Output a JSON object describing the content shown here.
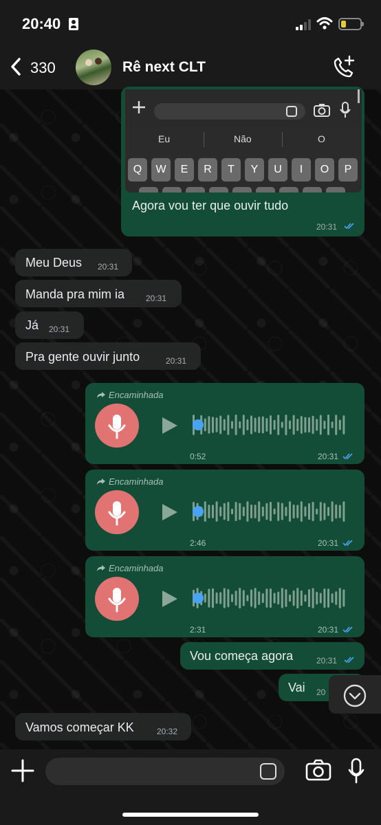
{
  "status_bar": {
    "time": "20:40"
  },
  "header": {
    "back_count": "330",
    "contact_name": "Rê next CLT"
  },
  "screenshot_keyboard": {
    "suggestions": [
      "Eu",
      "Não",
      "O"
    ],
    "keys": [
      "Q",
      "W",
      "E",
      "R",
      "T",
      "Y",
      "U",
      "I",
      "O",
      "P"
    ]
  },
  "messages": [
    {
      "type": "out",
      "text": "Agora vou ter que ouvir tudo",
      "time": "20:31"
    },
    {
      "type": "in",
      "text": "Meu Deus",
      "time": "20:31"
    },
    {
      "type": "in",
      "text": "Manda pra mim ia",
      "time": "20:31"
    },
    {
      "type": "in",
      "text": "Já",
      "time": "20:31"
    },
    {
      "type": "in",
      "text": "Pra gente ouvir junto",
      "time": "20:31"
    }
  ],
  "voice_messages": [
    {
      "forwarded_label": "Encaminhada",
      "duration": "0:52",
      "time": "20:31"
    },
    {
      "forwarded_label": "Encaminhada",
      "duration": "2:46",
      "time": "20:31"
    },
    {
      "forwarded_label": "Encaminhada",
      "duration": "2:31",
      "time": "20:31"
    }
  ],
  "later_messages": [
    {
      "type": "out",
      "text": "Vou começa agora",
      "time": "20:31"
    },
    {
      "type": "out",
      "text": "Vai",
      "time": "20"
    },
    {
      "type": "in",
      "text": "Vamos começar KK",
      "time": "20:32"
    }
  ],
  "colors": {
    "outgoing": "#134d37",
    "incoming": "#242626",
    "read_ticks": "#4aa3f2",
    "mic_circle": "#e27373"
  }
}
